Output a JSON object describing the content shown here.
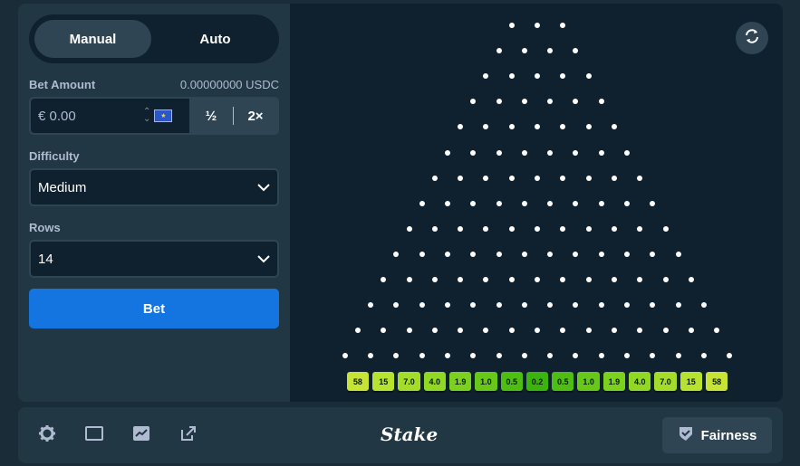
{
  "tabs": {
    "manual": "Manual",
    "auto": "Auto"
  },
  "bet_amount": {
    "label": "Bet Amount",
    "balance": "0.00000000 USDC",
    "value": "€ 0.00",
    "half": "½",
    "double": "2×"
  },
  "difficulty": {
    "label": "Difficulty",
    "value": "Medium"
  },
  "rows": {
    "label": "Rows",
    "value": "14"
  },
  "bet_button": "Bet",
  "board": {
    "rows": 14,
    "multipliers": [
      "58",
      "15",
      "7.0",
      "4.0",
      "1.9",
      "1.0",
      "0.5",
      "0.2",
      "0.5",
      "1.0",
      "1.9",
      "4.0",
      "7.0",
      "15",
      "58"
    ],
    "bucket_colors": [
      "#c7e336",
      "#b6e230",
      "#a3dd2a",
      "#90d824",
      "#7cd01e",
      "#67c819",
      "#4fbe13",
      "#3bb40e",
      "#4fbe13",
      "#67c819",
      "#7cd01e",
      "#90d824",
      "#a3dd2a",
      "#b6e230",
      "#c7e336"
    ]
  },
  "footer": {
    "logo": "Stake",
    "fairness": "Fairness"
  },
  "colors": {
    "accent": "#1475e1",
    "panel": "#213743",
    "stage": "#0f212e"
  }
}
